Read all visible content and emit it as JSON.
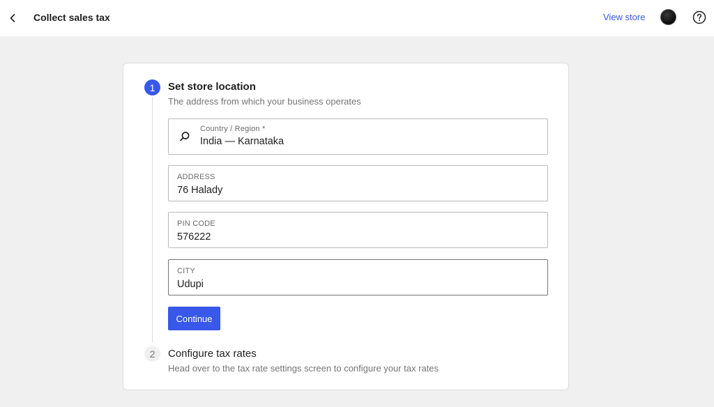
{
  "header": {
    "title": "Collect sales tax",
    "view_store_label": "View store"
  },
  "steps": [
    {
      "number": "1",
      "title": "Set store location",
      "description": "The address from which your business operates"
    },
    {
      "number": "2",
      "title": "Configure tax rates",
      "description": "Head over to the tax rate settings screen to configure your tax rates"
    }
  ],
  "form": {
    "country": {
      "label": "Country / Region *",
      "value": "India — Karnataka"
    },
    "address": {
      "label": "ADDRESS",
      "value": "76 Halady"
    },
    "pincode": {
      "label": "PIN CODE",
      "value": "576222"
    },
    "city": {
      "label": "CITY",
      "value": "Udupi"
    },
    "continue_label": "Continue"
  },
  "colors": {
    "accent": "#3858e9",
    "background": "#f0f0f0",
    "card": "#ffffff"
  },
  "icons": [
    "chevron-left-icon",
    "avatar",
    "help-icon",
    "search-icon"
  ]
}
